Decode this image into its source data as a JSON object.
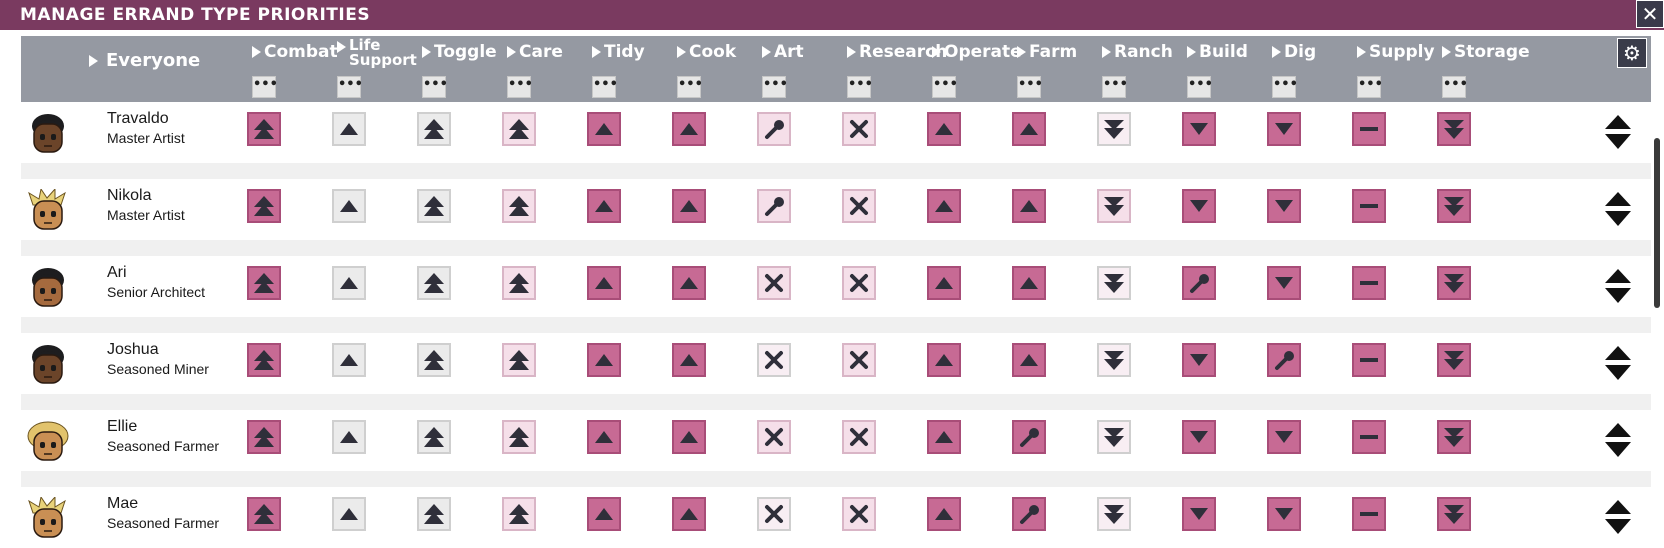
{
  "window": {
    "title": "MANAGE ERRAND TYPE PRIORITIES",
    "close_glyph": "✕"
  },
  "header": {
    "everyone_label": "Everyone",
    "more_glyph": "•••",
    "columns": [
      {
        "label": "Combat"
      },
      {
        "label": "Life",
        "label2": "Support"
      },
      {
        "label": "Toggle"
      },
      {
        "label": "Care"
      },
      {
        "label": "Tidy"
      },
      {
        "label": "Cook"
      },
      {
        "label": "Art"
      },
      {
        "label": "Research"
      },
      {
        "label": "Operate"
      },
      {
        "label": "Farm"
      },
      {
        "label": "Ranch"
      },
      {
        "label": "Build"
      },
      {
        "label": "Dig"
      },
      {
        "label": "Supply"
      },
      {
        "label": "Storage"
      }
    ],
    "settings_icon": "gear-icon"
  },
  "colors": {
    "titlebar": "#7a3a60",
    "header": "#9599a2",
    "high": "#c76a94",
    "light": "#ecd0de",
    "none": "#e8e8e8"
  },
  "duplicants": [
    {
      "name": "Travaldo",
      "role": "Master Artist",
      "hair": "dark",
      "skin": "#6b4429",
      "cells": [
        "vhigh-dark",
        "up-grey",
        "vhigh-grey",
        "vhigh-light",
        "up-dark",
        "up-dark",
        "wrench-light",
        "x-light",
        "up-dark",
        "up-dark",
        "vlow-pale",
        "down-dark",
        "down-dark",
        "dash-dark",
        "vlow-dark"
      ]
    },
    {
      "name": "Nikola",
      "role": "Master Artist",
      "hair": "blond",
      "skin": "#c98f54",
      "cells": [
        "vhigh-dark",
        "up-grey",
        "vhigh-grey",
        "vhigh-light",
        "up-dark",
        "up-dark",
        "wrench-light",
        "x-light",
        "up-dark",
        "up-dark",
        "vlow-light",
        "down-dark",
        "down-dark",
        "dash-dark",
        "vlow-dark"
      ]
    },
    {
      "name": "Ari",
      "role": "Senior Architect",
      "hair": "black",
      "skin": "#a56a3e",
      "cells": [
        "vhigh-dark",
        "up-grey",
        "vhigh-grey",
        "vhigh-light",
        "up-dark",
        "up-dark",
        "x-light",
        "x-light",
        "up-dark",
        "up-dark",
        "vlow-pale",
        "wrench-dark",
        "down-dark",
        "dash-dark",
        "vlow-dark"
      ]
    },
    {
      "name": "Joshua",
      "role": "Seasoned Miner",
      "hair": "dark",
      "skin": "#6b4429",
      "cells": [
        "vhigh-dark",
        "up-grey",
        "vhigh-grey",
        "vhigh-light",
        "up-dark",
        "up-dark",
        "x-pale",
        "x-light",
        "up-dark",
        "up-dark",
        "vlow-pale",
        "down-dark",
        "wrench-dark",
        "dash-dark",
        "vlow-dark"
      ]
    },
    {
      "name": "Ellie",
      "role": "Seasoned Farmer",
      "hair": "curly",
      "skin": "#c98f54",
      "cells": [
        "vhigh-dark",
        "up-grey",
        "vhigh-grey",
        "vhigh-light",
        "up-dark",
        "up-dark",
        "x-light",
        "x-light",
        "up-dark",
        "wrench-dark",
        "vlow-pale",
        "down-dark",
        "down-dark",
        "dash-dark",
        "vlow-dark"
      ]
    },
    {
      "name": "Mae",
      "role": "Seasoned Farmer",
      "hair": "blond",
      "skin": "#c98f54",
      "cells": [
        "vhigh-dark",
        "up-grey",
        "vhigh-grey",
        "vhigh-light",
        "up-dark",
        "up-dark",
        "x-pale",
        "x-light",
        "up-dark",
        "wrench-dark",
        "vlow-pale",
        "down-dark",
        "down-dark",
        "dash-dark",
        "vlow-dark"
      ]
    }
  ]
}
